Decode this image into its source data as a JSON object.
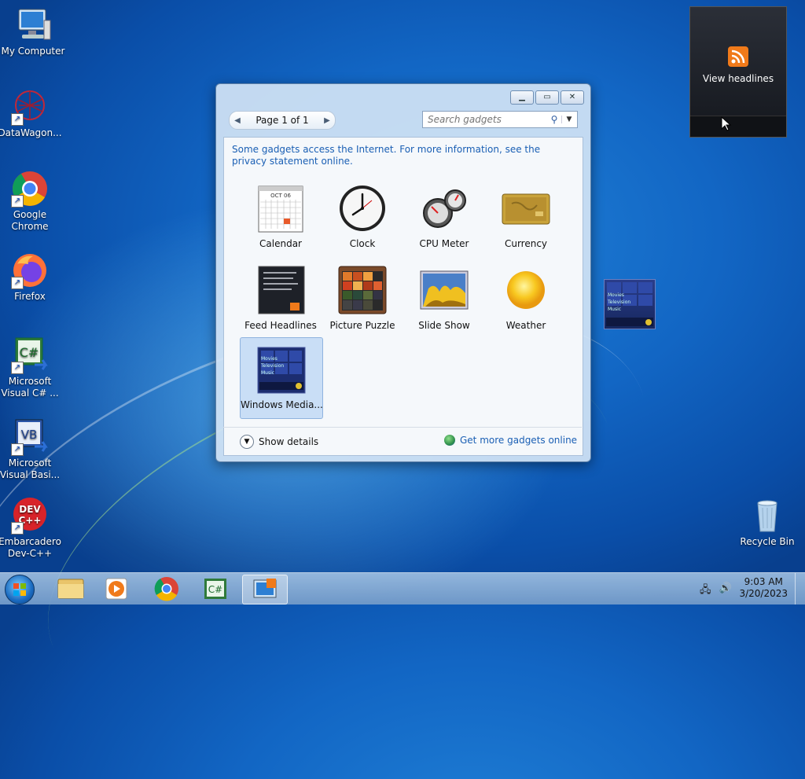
{
  "desktop": {
    "icons": [
      {
        "label": "My Computer"
      },
      {
        "label": "DataWagon..."
      },
      {
        "label": "Google Chrome"
      },
      {
        "label": "Firefox"
      },
      {
        "label": "Microsoft Visual C# ..."
      },
      {
        "label": "Microsoft Visual Basi..."
      },
      {
        "label": "Embarcadero Dev-C++"
      },
      {
        "label": "Recycle Bin"
      }
    ]
  },
  "gadget_window": {
    "pager": {
      "text": "Page 1 of 1"
    },
    "search": {
      "placeholder": "Search gadgets"
    },
    "notice": "Some gadgets access the Internet.  For more information, see the privacy statement online.",
    "gadgets": [
      {
        "label": "Calendar",
        "icon": "calendar-icon"
      },
      {
        "label": "Clock",
        "icon": "clock-icon"
      },
      {
        "label": "CPU Meter",
        "icon": "cpu-meter-icon"
      },
      {
        "label": "Currency",
        "icon": "currency-icon"
      },
      {
        "label": "Feed Headlines",
        "icon": "feed-headlines-icon"
      },
      {
        "label": "Picture Puzzle",
        "icon": "picture-puzzle-icon"
      },
      {
        "label": "Slide Show",
        "icon": "slide-show-icon"
      },
      {
        "label": "Weather",
        "icon": "weather-icon"
      },
      {
        "label": "Windows Media...",
        "icon": "windows-media-icon",
        "selected": true
      }
    ],
    "calendar_month": "OCT 06",
    "show_details": "Show details",
    "get_more": "Get more gadgets online"
  },
  "headlines_gadget": {
    "label": "View headlines"
  },
  "media_thumb": {
    "lines": [
      "Movies",
      "Television",
      "Music"
    ]
  },
  "taskbar": {
    "time": "9:03 AM",
    "date": "3/20/2023"
  },
  "colors": {
    "link": "#1a5fb4",
    "rss": "#f07a1a"
  }
}
